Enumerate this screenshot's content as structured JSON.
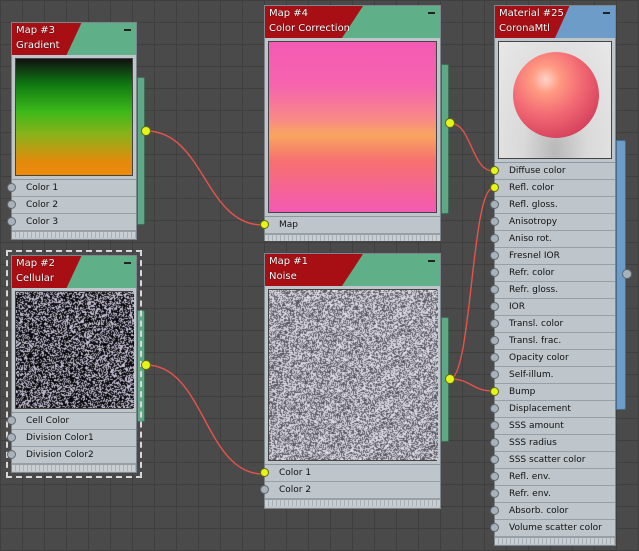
{
  "colors": {
    "wire": "#e8524a",
    "socket_connected": "#e5f51a",
    "header_red": "#a80f14"
  },
  "nodes": {
    "gradient": {
      "title": "Map #3",
      "subtitle": "Gradient",
      "preview": "gradient-preview",
      "slots": [
        "Color 1",
        "Color 2",
        "Color 3"
      ]
    },
    "color_correction": {
      "title": "Map #4",
      "subtitle": "Color Correction",
      "preview": "color-correction-preview",
      "slots": [
        "Map"
      ]
    },
    "cellular": {
      "title": "Map #2",
      "subtitle": "Cellular",
      "preview": "cellular-preview",
      "slots": [
        "Cell Color",
        "Division Color1",
        "Division Color2"
      ]
    },
    "noise": {
      "title": "Map #1",
      "subtitle": "Noise",
      "preview": "noise-preview",
      "slots": [
        "Color 1",
        "Color 2"
      ]
    },
    "material": {
      "title": "Material #25",
      "subtitle": "CoronaMtl",
      "preview": "sphere-preview",
      "slots": [
        "Diffuse color",
        "Refl. color",
        "Refl. gloss.",
        "Anisotropy",
        "Aniso rot.",
        "Fresnel IOR",
        "Refr. color",
        "Refr. gloss.",
        "IOR",
        "Transl. color",
        "Transl. frac.",
        "Opacity color",
        "Self-illum.",
        "Bump",
        "Displacement",
        "SSS amount",
        "SSS radius",
        "SSS scatter color",
        "Refl. env.",
        "Refr. env.",
        "Absorb. color",
        "Volume scatter color"
      ]
    }
  }
}
